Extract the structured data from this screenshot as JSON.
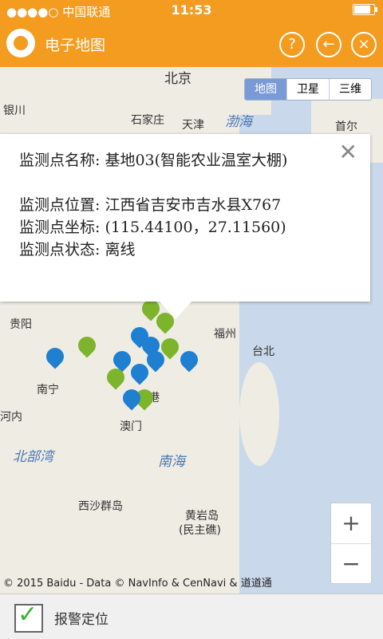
{
  "status": {
    "carrier": "●●●●○ 中国联通",
    "time": "11:53"
  },
  "topbar": {
    "title": "电子地图",
    "help_label": "?",
    "back_label": "←",
    "close_label": "×"
  },
  "map": {
    "type_tabs": [
      "地图",
      "卫星",
      "三维"
    ],
    "labels": {
      "beijing": "北京",
      "yinchuan": "银川",
      "shijiazhuang": "石家庄",
      "tianjin": "天津",
      "bohai": "渤海",
      "seoul": "首尔",
      "guiyang": "贵阳",
      "fuzhou": "福州",
      "taibei": "台北",
      "nanning": "南宁",
      "hanoi": "河内",
      "aomen": "澳门",
      "xiang": "港",
      "beibuwan": "北部湾",
      "nanhai": "南海",
      "xisha": "西沙群岛",
      "huangyan": "黄岩岛",
      "minzhu": "(民主礁)"
    },
    "copyright": "© 2015 Baidu - Data © NavInfo & CenNavi & 道道通",
    "zoom_in": "+",
    "zoom_out": "−"
  },
  "popup": {
    "close": "✕",
    "line1": "监测点名称: 基地03(智能农业温室大棚)",
    "line2": "监测点位置: 江西省吉安市吉水县X767",
    "line3": "监测点坐标: (115.44100，27.11560)",
    "line4": "监测点状态: 离线"
  },
  "bottom": {
    "checkbox_mark": "✓",
    "label": "报警定位"
  },
  "colors": {
    "accent": "#f39c1f",
    "pin_blue": "#1f7fd0",
    "pin_green": "#7cb42c"
  }
}
